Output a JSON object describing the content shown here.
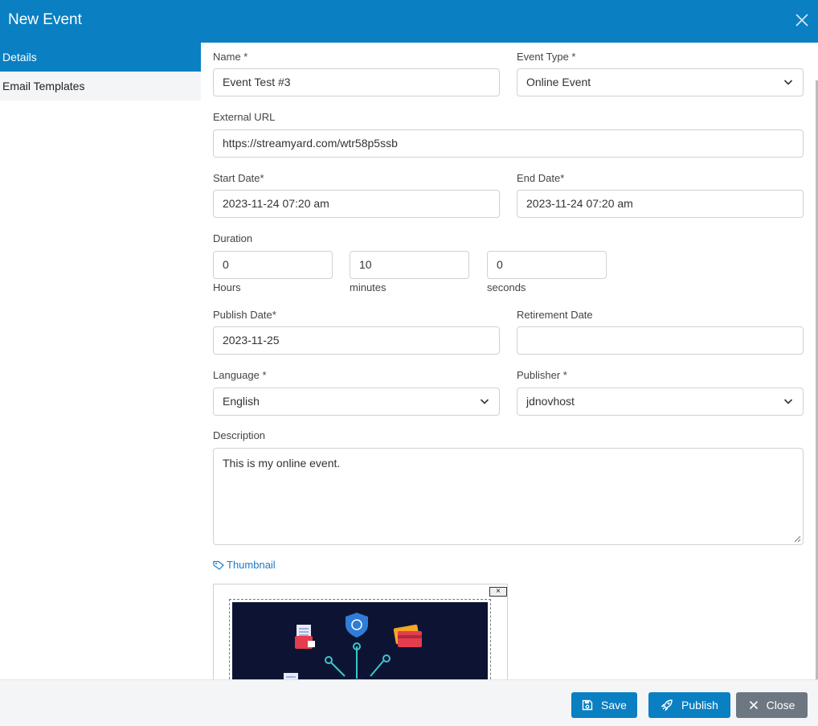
{
  "dialog": {
    "title": "New Event"
  },
  "sidebar": {
    "items": [
      {
        "label": "Details"
      },
      {
        "label": "Email Templates"
      }
    ]
  },
  "form": {
    "name": {
      "label": "Name *",
      "value": "Event Test #3"
    },
    "event_type": {
      "label": "Event Type *",
      "value": "Online Event"
    },
    "external_url": {
      "label": "External URL",
      "value": "https://streamyard.com/wtr58p5ssb"
    },
    "start_date": {
      "label": "Start Date*",
      "value": "2023-11-24 07:20 am"
    },
    "end_date": {
      "label": "End Date*",
      "value": "2023-11-24 07:20 am"
    },
    "duration": {
      "label": "Duration",
      "hours": {
        "value": "0",
        "unit": "Hours"
      },
      "minutes": {
        "value": "10",
        "unit": "minutes"
      },
      "seconds": {
        "value": "0",
        "unit": "seconds"
      }
    },
    "publish_date": {
      "label": "Publish Date*",
      "value": "2023-11-25"
    },
    "retirement_date": {
      "label": "Retirement Date",
      "value": ""
    },
    "language": {
      "label": "Language *",
      "value": "English"
    },
    "publisher": {
      "label": "Publisher *",
      "value": "jdnovhost"
    },
    "description": {
      "label": "Description",
      "value": "This is my online event."
    },
    "thumbnail": {
      "label": "Thumbnail",
      "remove_label": "×"
    }
  },
  "footer": {
    "save_label": "Save",
    "publish_label": "Publish",
    "close_label": "Close"
  },
  "colors": {
    "primary": "#0a7fc2",
    "secondary": "#6c7781",
    "link": "#1d79c4"
  },
  "icons": [
    "close-icon",
    "chevron-down-icon",
    "tag-icon",
    "save-icon",
    "rocket-icon",
    "x-icon"
  ]
}
